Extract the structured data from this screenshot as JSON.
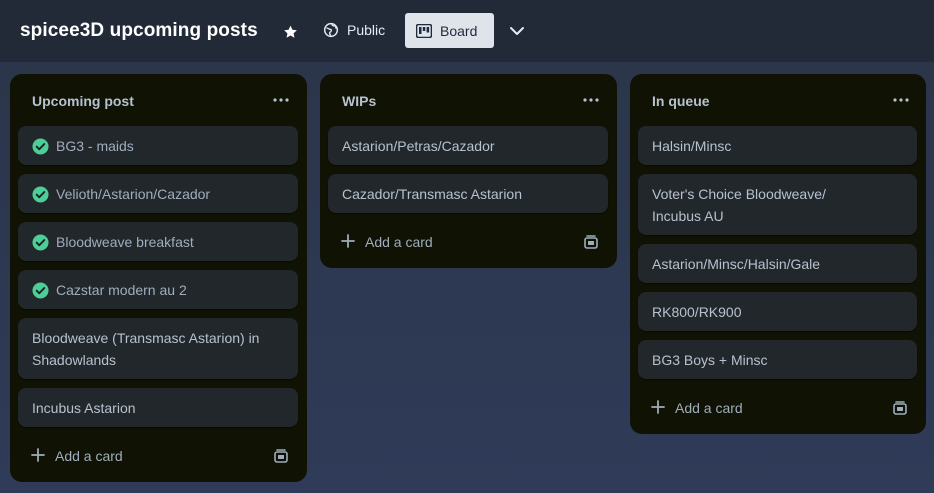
{
  "header": {
    "board_title": "spicee3D upcoming posts",
    "visibility_label": "Public",
    "view_label": "Board"
  },
  "lists": [
    {
      "title": "Upcoming post",
      "cards": [
        {
          "text": "BG3 - maids",
          "done": true
        },
        {
          "text": "Velioth/Astarion/Cazador",
          "done": true
        },
        {
          "text": "Bloodweave breakfast",
          "done": true
        },
        {
          "text": "Cazstar modern au 2",
          "done": true
        },
        {
          "text": "Bloodweave (Transmasc Astarion) in Shadowlands",
          "done": false
        },
        {
          "text": "Incubus Astarion",
          "done": false
        }
      ],
      "add_label": "Add a card"
    },
    {
      "title": "WIPs",
      "cards": [
        {
          "text": "Astarion/Petras/Cazador",
          "done": false
        },
        {
          "text": "Cazador/Transmasc Astarion",
          "done": false
        }
      ],
      "add_label": "Add a card"
    },
    {
      "title": "In queue",
      "cards": [
        {
          "text": "Halsin/Minsc",
          "done": false
        },
        {
          "text": "Voter's Choice Bloodweave/ Incubus AU",
          "done": false
        },
        {
          "text": "Astarion/Minsc/Halsin/Gale",
          "done": false
        },
        {
          "text": "RK800/RK900",
          "done": false
        },
        {
          "text": "BG3 Boys + Minsc",
          "done": false
        }
      ],
      "add_label": "Add a card"
    }
  ],
  "colors": {
    "topbar": "#222a38",
    "list_bg": "#101204",
    "card_bg": "#22272b",
    "check_green": "#4bce97"
  }
}
